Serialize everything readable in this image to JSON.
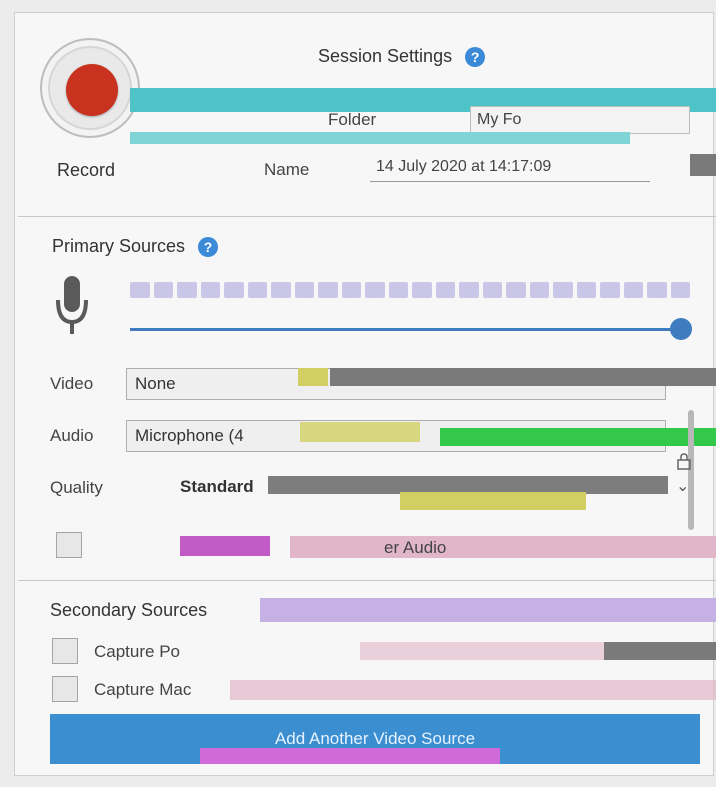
{
  "session": {
    "title": "Session Settings",
    "record_label": "Record",
    "folder_label": "Folder",
    "folder_value": "My Fo",
    "name_label": "Name",
    "name_value": "14 July 2020 at 14:17:09"
  },
  "primary": {
    "title": "Primary Sources",
    "video_label": "Video",
    "video_value": "None",
    "audio_label": "Audio",
    "audio_value": "Microphone (4",
    "quality_label": "Quality",
    "quality_value": "Standard",
    "capture_audio_label": "er Audio",
    "volume_level": 1.0
  },
  "secondary": {
    "title": "Secondary Sources",
    "capture_screen_label": "Capture Po",
    "capture_mac_label": "Capture Mac",
    "add_button_label": "Add Another Video Source"
  },
  "icons": {
    "help": "help-icon",
    "mic": "microphone-icon",
    "lock": "lock-icon",
    "chevron": "chevron-down-icon"
  },
  "colors": {
    "accent": "#3b8fd0",
    "record": "#c8321f"
  }
}
